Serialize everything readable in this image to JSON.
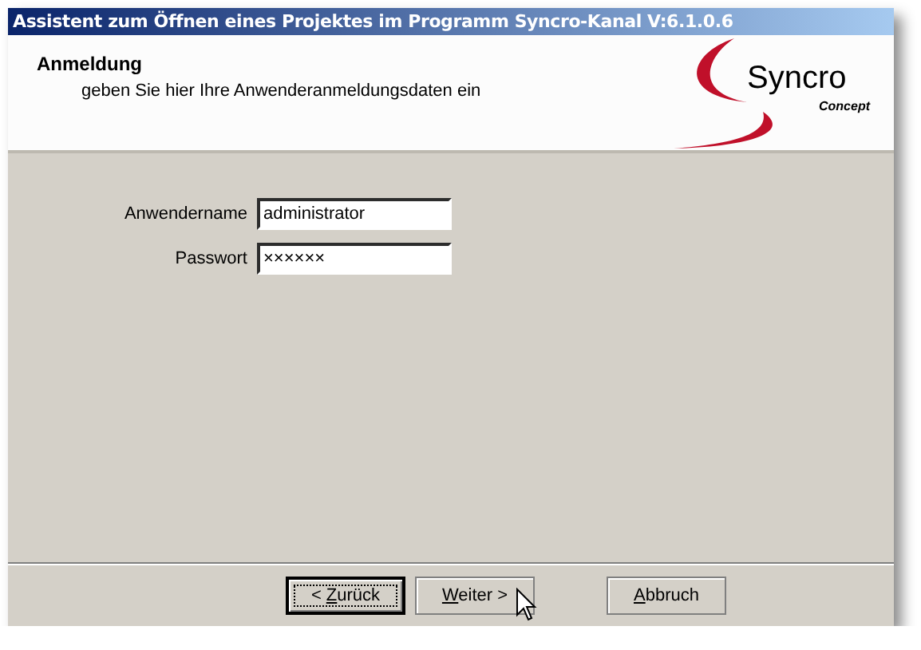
{
  "window": {
    "title": "Assistent zum Öffnen eines Projektes im Programm Syncro-Kanal V:6.1.0.6"
  },
  "header": {
    "title": "Anmeldung",
    "subtitle": "geben Sie hier Ihre Anwenderanmeldungsdaten ein",
    "logo": {
      "name": "Syncro",
      "tagline": "Concept"
    }
  },
  "fields": [
    {
      "label": "Anwendername",
      "value": "administrator"
    },
    {
      "label": "Passwort",
      "value": "××××××"
    }
  ],
  "buttons": [
    {
      "prefix": "< ",
      "access_key": "Z",
      "rest": "urück",
      "default": true
    },
    {
      "access_key": "W",
      "rest": "eiter >",
      "default": false
    },
    {
      "access_key": "A",
      "rest": "bbruch",
      "default": false
    }
  ]
}
